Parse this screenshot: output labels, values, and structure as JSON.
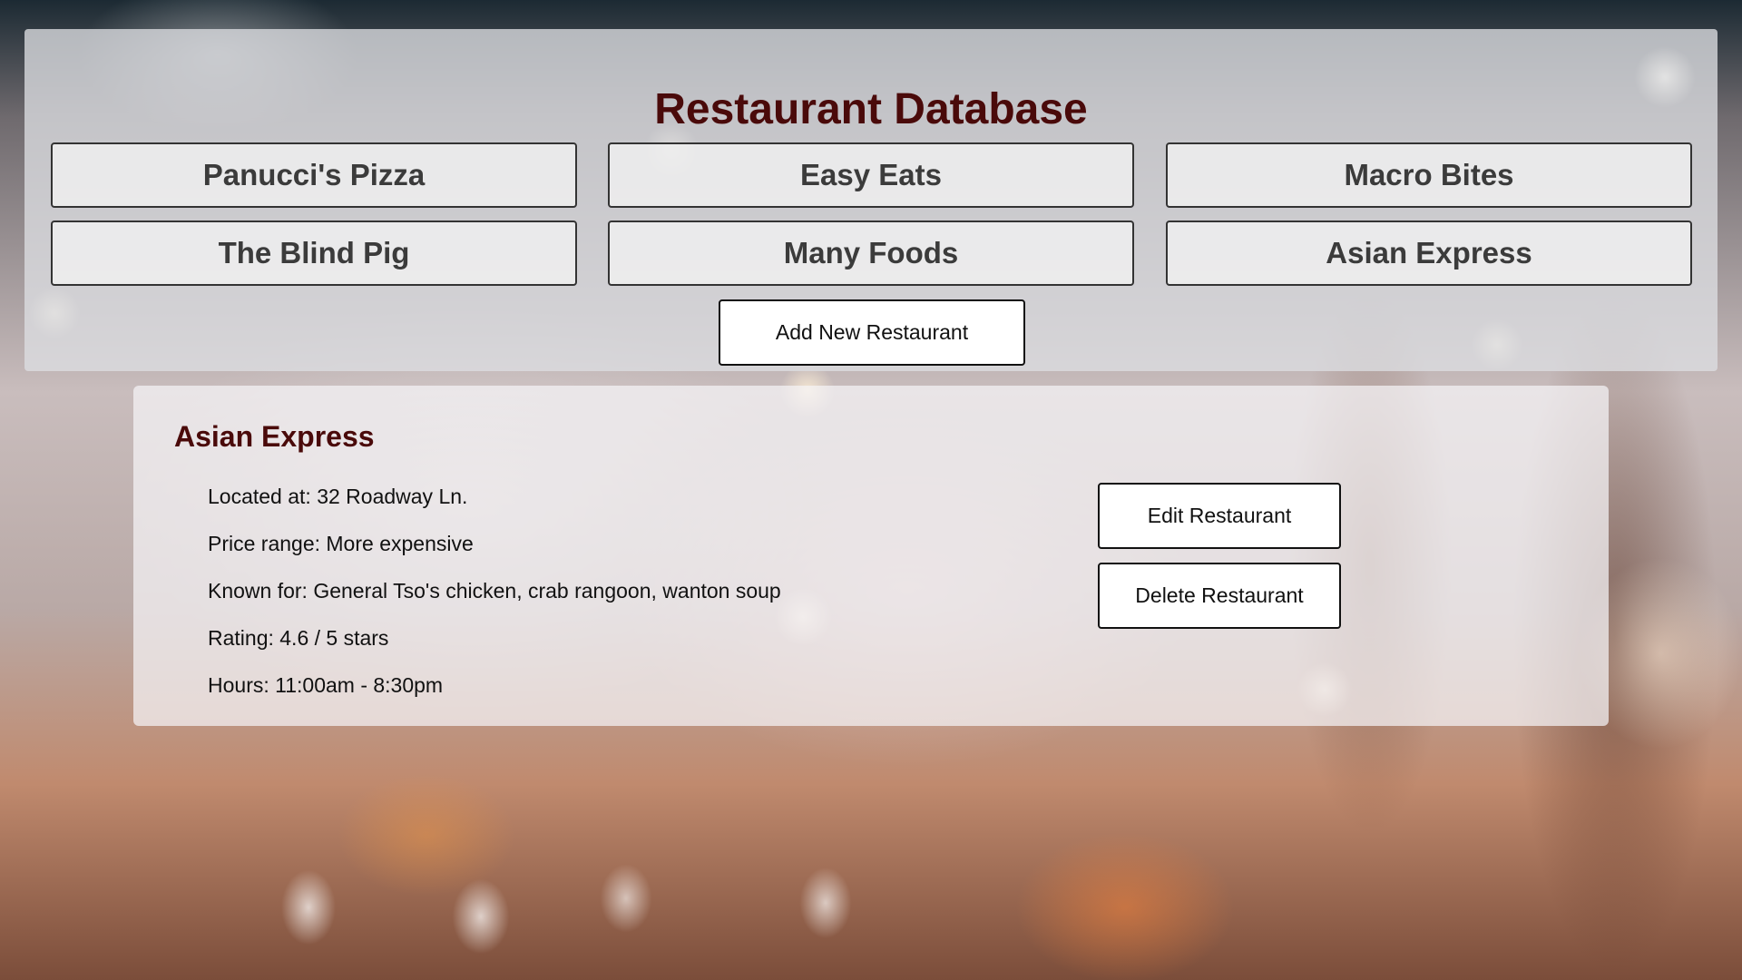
{
  "header": {
    "title": "Restaurant Database"
  },
  "restaurants": [
    {
      "label": "Panucci's Pizza"
    },
    {
      "label": "Easy Eats"
    },
    {
      "label": "Macro Bites"
    },
    {
      "label": "The Blind Pig"
    },
    {
      "label": "Many Foods"
    },
    {
      "label": "Asian Express"
    }
  ],
  "add_button_label": "Add New Restaurant",
  "selected": {
    "name": "Asian Express",
    "location": "Located at: 32 Roadway Ln.",
    "price": "Price range: More expensive",
    "known_for": "Known for: General Tso's chicken, crab rangoon, wanton soup",
    "rating": "Rating: 4.6 / 5 stars",
    "hours": "Hours: 11:00am - 8:30pm"
  },
  "actions": {
    "edit_label": "Edit Restaurant",
    "delete_label": "Delete Restaurant"
  },
  "colors": {
    "heading": "#4a0a0a",
    "button_border": "#333333"
  }
}
